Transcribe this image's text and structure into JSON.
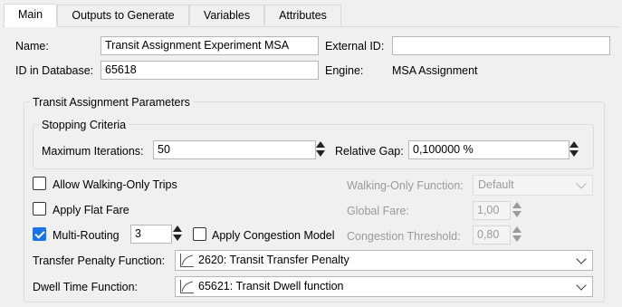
{
  "tabs": [
    {
      "label": "Main"
    },
    {
      "label": "Outputs to Generate"
    },
    {
      "label": "Variables"
    },
    {
      "label": "Attributes"
    }
  ],
  "main": {
    "name_label": "Name:",
    "name_value": "Transit Assignment Experiment MSA",
    "external_id_label": "External ID:",
    "external_id_value": "",
    "id_label": "ID in Database:",
    "id_value": "65618",
    "engine_label": "Engine:",
    "engine_value": "MSA Assignment"
  },
  "params": {
    "group_title": "Transit Assignment Parameters",
    "stopping_title": "Stopping Criteria",
    "max_iter_label": "Maximum Iterations:",
    "max_iter_value": "50",
    "rel_gap_label": "Relative Gap:",
    "rel_gap_value": "0,100000 %",
    "allow_walking_label": "Allow Walking-Only Trips",
    "allow_walking_checked": false,
    "walking_fn_label": "Walking-Only Function:",
    "walking_fn_value": "Default",
    "flat_fare_label": "Apply Flat Fare",
    "flat_fare_checked": false,
    "global_fare_label": "Global Fare:",
    "global_fare_value": "1,00",
    "multi_routing_label": "Multi-Routing",
    "multi_routing_checked": true,
    "multi_routing_value": "3",
    "congestion_label": "Apply Congestion Model",
    "congestion_checked": false,
    "congestion_threshold_label": "Congestion Threshold:",
    "congestion_threshold_value": "0,80",
    "transfer_penalty_label": "Transfer Penalty Function:",
    "transfer_penalty_value": "2620: Transit Transfer Penalty",
    "dwell_time_label": "Dwell Time Function:",
    "dwell_time_value": "65621: Transit Dwell function"
  },
  "colors": {
    "accent": "#1a73e8",
    "background": "#f0f0f0"
  }
}
